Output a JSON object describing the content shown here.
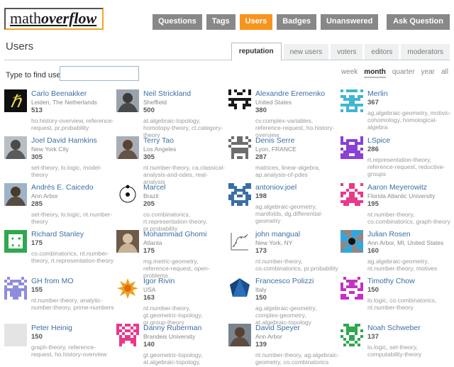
{
  "site": {
    "logo_light": "math",
    "logo_bold": "overflow",
    "accent_color": "#f7941d",
    "nav_bg": "#888888"
  },
  "nav": {
    "items": [
      {
        "label": "Questions",
        "active": false
      },
      {
        "label": "Tags",
        "active": false
      },
      {
        "label": "Users",
        "active": true
      },
      {
        "label": "Badges",
        "active": false
      },
      {
        "label": "Unanswered",
        "active": false
      }
    ],
    "ask_label": "Ask Question"
  },
  "page": {
    "title": "Users"
  },
  "tabs": [
    {
      "label": "reputation",
      "active": true
    },
    {
      "label": "new users",
      "active": false
    },
    {
      "label": "voters",
      "active": false
    },
    {
      "label": "editors",
      "active": false
    },
    {
      "label": "moderators",
      "active": false
    }
  ],
  "search": {
    "label": "Type to find users:",
    "value": "",
    "placeholder": ""
  },
  "periods": [
    {
      "label": "week",
      "selected": false
    },
    {
      "label": "month",
      "selected": true
    },
    {
      "label": "quarter",
      "selected": false
    },
    {
      "label": "year",
      "selected": false
    },
    {
      "label": "all",
      "selected": false
    }
  ],
  "users": [
    {
      "name": "Carlo Beenakker",
      "location": "Leiden, The Netherlands",
      "reputation": "513",
      "tags": "ho.history-overview, reference-request, pr.probability",
      "avatar": {
        "kind": "hbar",
        "bg": "#101010",
        "fg": "#f2e14c"
      }
    },
    {
      "name": "Neil Strickland",
      "location": "Sheffield",
      "reputation": "500",
      "tags": "at.algebraic-topology, homotopy-theory, ct.category-theory",
      "avatar": {
        "kind": "photo",
        "bg": "#9aa3ad",
        "fg": "#3b3b3b"
      }
    },
    {
      "name": "Alexandre Eremenko",
      "location": "United States",
      "reputation": "380",
      "tags": "cv.complex-variables, reference-request, ho.history-overview",
      "avatar": {
        "kind": "identicon",
        "bg": "#1b1b1b",
        "fg": "#ffffff"
      }
    },
    {
      "name": "Merlin",
      "location": "",
      "reputation": "367",
      "tags": "ag.algebraic-geometry, motivic-cohomology, homological-algebra",
      "avatar": {
        "kind": "identicon",
        "bg": "#ffffff",
        "fg": "#3fb6d3"
      }
    },
    {
      "name": "Joel David Hamkins",
      "location": "New York City",
      "reputation": "305",
      "tags": "set-theory, lo.logic, model-theory",
      "avatar": {
        "kind": "photo",
        "bg": "#b9bec4",
        "fg": "#4a4a4a"
      }
    },
    {
      "name": "Terry Tao",
      "location": "Los Angeles",
      "reputation": "305",
      "tags": "nt.number-theory, ca.classical-analysis-and-odes, real-analysis",
      "avatar": {
        "kind": "photo",
        "bg": "#a8aeb6",
        "fg": "#5a4334"
      }
    },
    {
      "name": "Denis Serre",
      "location": "Lyon, FRANCE",
      "reputation": "287",
      "tags": "matrices, linear-algebra, ap.analysis-of-pdes",
      "avatar": {
        "kind": "identicon",
        "bg": "#ffffff",
        "fg": "#6d6d6d"
      }
    },
    {
      "name": "LSpice",
      "location": "",
      "reputation": "286",
      "tags": "rt.representation-theory, reference-request, reductive-groups",
      "avatar": {
        "kind": "identicon",
        "bg": "#ffffff",
        "fg": "#8b3fd4"
      }
    },
    {
      "name": "Andrés E. Caicedo",
      "location": "Ann Arbor",
      "reputation": "285",
      "tags": "set-theory, lo.logic, nt.number-theory",
      "avatar": {
        "kind": "photo",
        "bg": "#9fb3c8",
        "fg": "#4a3a2a"
      }
    },
    {
      "name": "Marcel",
      "location": "Brazil",
      "reputation": "205",
      "tags": "co.combinatorics, rt.representation-theory, pr.probability",
      "avatar": {
        "kind": "atom",
        "bg": "#ffffff",
        "fg": "#111111"
      }
    },
    {
      "name": "antoniov.joel",
      "location": "",
      "reputation": "198",
      "tags": "ag.algebraic-geometry, manifolds, dg.differential-geometry",
      "avatar": {
        "kind": "identicon",
        "bg": "#ffffff",
        "fg": "#3b6ea5"
      }
    },
    {
      "name": "Aaron Meyerowitz",
      "location": "Florida Atlantic University",
      "reputation": "195",
      "tags": "nt.number-theory, co.combinatorics, graph-theory",
      "avatar": {
        "kind": "identicon",
        "bg": "#ffffff",
        "fg": "#e8398b"
      }
    },
    {
      "name": "Richard Stanley",
      "location": "",
      "reputation": "175",
      "tags": "co.combinatorics, nt.number-theory, rt.representation-theory",
      "avatar": {
        "kind": "cards",
        "bg": "#2fa84f",
        "fg": "#ffffff"
      }
    },
    {
      "name": "Mohammad Ghomi",
      "location": "Atlanta",
      "reputation": "175",
      "tags": "mg.metric-geometry, reference-request, open-problems",
      "avatar": {
        "kind": "photo",
        "bg": "#6e5a48",
        "fg": "#d8c2a8"
      }
    },
    {
      "name": "john mangual",
      "location": "New York, NY",
      "reputation": "173",
      "tags": "nt.number-theory, co.combinatorics, pr.probability",
      "avatar": {
        "kind": "sketch",
        "bg": "#ffffff",
        "fg": "#5a5a5a"
      }
    },
    {
      "name": "Julian Rosen",
      "location": "Ann Arbor, MI, United States",
      "reputation": "160",
      "tags": "ag.algebraic-geometry, nt.number-theory, motives",
      "avatar": {
        "kind": "pinwheel",
        "bg": "#8a8a8a",
        "fg": "#2fa8e0"
      }
    },
    {
      "name": "GH from MO",
      "location": "",
      "reputation": "155",
      "tags": "nt.number-theory, analytic-number-theory, prime-numbers",
      "avatar": {
        "kind": "identicon",
        "bg": "#ffffff",
        "fg": "#8f8ddb"
      }
    },
    {
      "name": "Igor Rivin",
      "location": "USA",
      "reputation": "163",
      "tags": "nt.number-theory, gt.geometric-topology, gr.group-theory",
      "avatar": {
        "kind": "sun",
        "bg": "#ffffff",
        "fg": "#f0a01e"
      }
    },
    {
      "name": "Francesco Polizzi",
      "location": "Italy",
      "reputation": "150",
      "tags": "ag.algebraic-geometry, complex-geometry, at.algebraic-topology",
      "avatar": {
        "kind": "polyhedron",
        "bg": "#ffffff",
        "fg": "#1c4f91"
      }
    },
    {
      "name": "Timothy Chow",
      "location": "",
      "reputation": "150",
      "tags": "lo.logic, co.combinatorics, nt.number-theory",
      "avatar": {
        "kind": "identicon",
        "bg": "#ffffff",
        "fg": "#c530c5"
      }
    },
    {
      "name": "Peter Heinig",
      "location": "",
      "reputation": "150",
      "tags": "graph-theory, reference-request, ho.history-overview",
      "avatar": {
        "kind": "blank",
        "bg": "#e4e4e4",
        "fg": "#e4e4e4"
      }
    },
    {
      "name": "Danny Ruberman",
      "location": "Brandeis University",
      "reputation": "140",
      "tags": "gt.geometric-topology, at.algebraic-topology, dg.differential-geometry",
      "avatar": {
        "kind": "identicon",
        "bg": "#ffffff",
        "fg": "#e8398b"
      }
    },
    {
      "name": "David Speyer",
      "location": "Ann Arbor",
      "reputation": "139",
      "tags": "nt.number-theory, ag.algebraic-geometry, co.combinatorics",
      "avatar": {
        "kind": "photo",
        "bg": "#77848e",
        "fg": "#5a4030"
      }
    },
    {
      "name": "Noah Schweber",
      "location": "",
      "reputation": "137",
      "tags": "lo.logic, set-theory, computability-theory",
      "avatar": {
        "kind": "identicon",
        "bg": "#ffffff",
        "fg": "#2fa84f"
      }
    }
  ]
}
